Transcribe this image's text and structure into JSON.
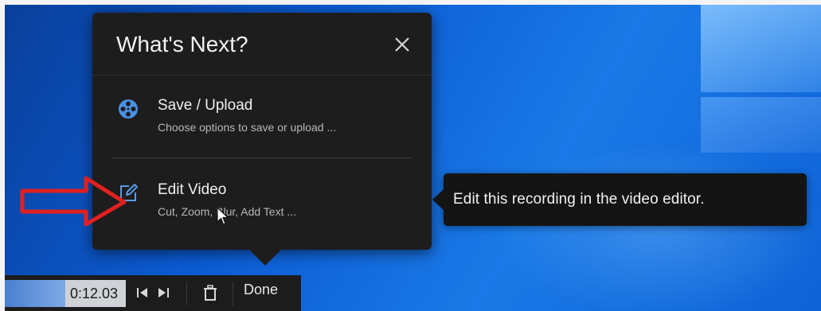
{
  "popup": {
    "title": "What's Next?",
    "close_icon": "close-icon",
    "options": [
      {
        "id": "save-upload",
        "icon": "film-reel-icon",
        "title": "Save / Upload",
        "subtitle": "Choose options to save or upload ..."
      },
      {
        "id": "edit-video",
        "icon": "edit-icon",
        "title": "Edit Video",
        "subtitle": "Cut, Zoom, Blur, Add Text ..."
      }
    ]
  },
  "tooltip": {
    "text": "Edit this recording in the video editor."
  },
  "toolbar": {
    "time": "0:12.03",
    "progress_fraction": 0.5,
    "done_label": "Done",
    "icons": [
      "skip-to-start-icon",
      "skip-to-end-icon",
      "trash-icon"
    ]
  },
  "colors": {
    "popup_bg": "#1d1d1e",
    "desktop_blue": "#0b5bd3",
    "annotation_red": "#e02020",
    "film_icon_blue": "#4a90e2"
  }
}
